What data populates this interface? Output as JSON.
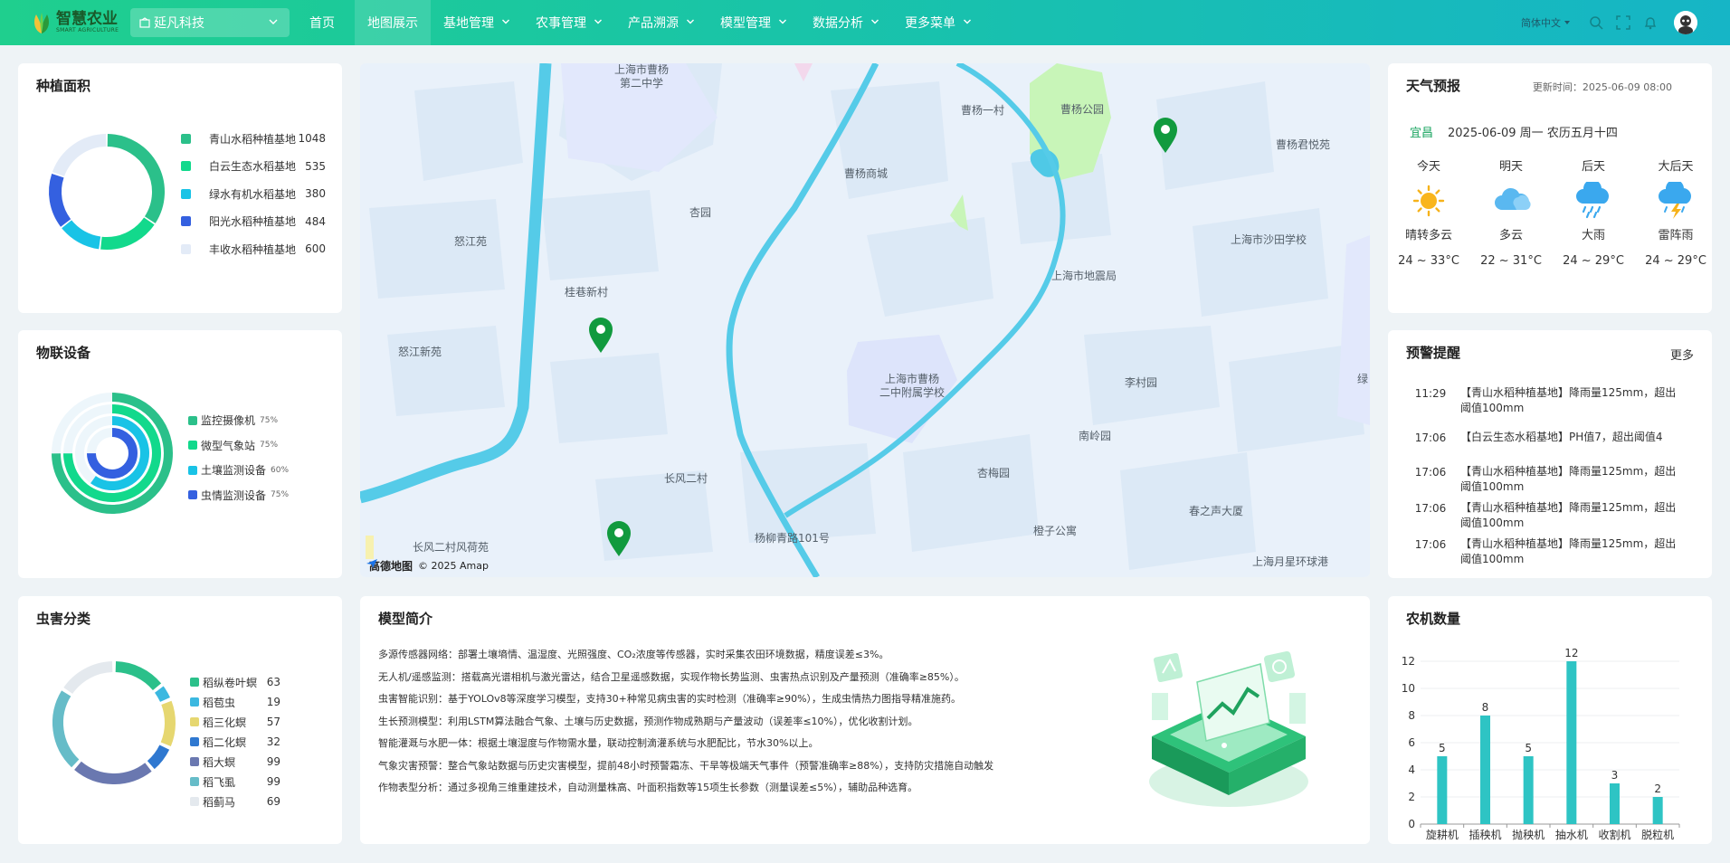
{
  "header": {
    "logo_title": "智慧农业",
    "logo_sub": "SMART AGRICULTURE",
    "company": "延凡科技",
    "nav": [
      {
        "label": "首页",
        "dropdown": false,
        "active": false
      },
      {
        "label": "地图展示",
        "dropdown": false,
        "active": true
      },
      {
        "label": "基地管理",
        "dropdown": true,
        "active": false
      },
      {
        "label": "农事管理",
        "dropdown": true,
        "active": false
      },
      {
        "label": "产品溯源",
        "dropdown": true,
        "active": false
      },
      {
        "label": "模型管理",
        "dropdown": true,
        "active": false
      },
      {
        "label": "数据分析",
        "dropdown": true,
        "active": false
      },
      {
        "label": "更多菜单",
        "dropdown": true,
        "active": false
      }
    ],
    "language": "简体中文"
  },
  "planting": {
    "title": "种植面积",
    "items": [
      {
        "name": "青山水稻种植基地",
        "value": 1048,
        "color": "#2bc08a"
      },
      {
        "name": "白云生态水稻基地",
        "value": 535,
        "color": "#12d98c"
      },
      {
        "name": "绿水有机水稻基地",
        "value": 380,
        "color": "#19c3e6"
      },
      {
        "name": "阳光水稻种植基地",
        "value": 484,
        "color": "#3460e0"
      },
      {
        "name": "丰收水稻种植基地",
        "value": 600,
        "color": "#e3ebf7"
      }
    ]
  },
  "iot": {
    "title": "物联设备",
    "items": [
      {
        "name": "监控摄像机",
        "percent": "75%",
        "fraction": 0.75,
        "color": "#2bc08a"
      },
      {
        "name": "微型气象站",
        "percent": "75%",
        "fraction": 0.75,
        "color": "#12d98c"
      },
      {
        "name": "土壤监测设备",
        "percent": "60%",
        "fraction": 0.6,
        "color": "#19c3e6"
      },
      {
        "name": "虫情监测设备",
        "percent": "75%",
        "fraction": 0.75,
        "color": "#3460e0"
      }
    ]
  },
  "pests": {
    "title": "虫害分类",
    "items": [
      {
        "name": "稻纵卷叶螟",
        "value": 63,
        "color": "#2bc08a"
      },
      {
        "name": "稻苞虫",
        "value": 19,
        "color": "#3bb8e0"
      },
      {
        "name": "稻三化螟",
        "value": 57,
        "color": "#e6d770"
      },
      {
        "name": "稻二化螟",
        "value": 32,
        "color": "#2f78d0"
      },
      {
        "name": "稻大螟",
        "value": 99,
        "color": "#6a78b0"
      },
      {
        "name": "稻飞虱",
        "value": 99,
        "color": "#66bcc8"
      },
      {
        "name": "稻蓟马",
        "value": 69,
        "color": "#e4e9ee"
      }
    ]
  },
  "map": {
    "labels": [
      {
        "id": "caoyang-2nd-school",
        "text": "上海市曹杨\n第二中学"
      },
      {
        "id": "caoyang-1village",
        "text": "曹杨一村"
      },
      {
        "id": "caoyang-park",
        "text": "曹杨公园"
      },
      {
        "id": "caoyang-mall",
        "text": "曹杨商城"
      },
      {
        "id": "caoyang-junyue",
        "text": "曹杨君悦苑"
      },
      {
        "id": "xingyuan",
        "text": "杏园"
      },
      {
        "id": "nujiang-yuan",
        "text": "怒江苑"
      },
      {
        "id": "shatian-school",
        "text": "上海市沙田学校"
      },
      {
        "id": "earthquake-bureau",
        "text": "上海市地震局"
      },
      {
        "id": "guixiang",
        "text": "桂巷新村"
      },
      {
        "id": "nujiang-new",
        "text": "怒江新苑"
      },
      {
        "id": "caoyang-2nd-affiliated",
        "text": "上海市曹杨\n二中附属学校"
      },
      {
        "id": "licunyuan",
        "text": "李村园"
      },
      {
        "id": "lu",
        "text": "绿"
      },
      {
        "id": "nanling",
        "text": "南岭园"
      },
      {
        "id": "changfeng2",
        "text": "长风二村"
      },
      {
        "id": "xingmei",
        "text": "杏梅园"
      },
      {
        "id": "chunzhisheng",
        "text": "春之声大厦"
      },
      {
        "id": "yangliuqing",
        "text": "杨柳青路101号"
      },
      {
        "id": "chengzi",
        "text": "橙子公寓"
      },
      {
        "id": "changfeng-lotus",
        "text": "长风二村风荷苑"
      },
      {
        "id": "yuexing",
        "text": "上海月星环球港"
      }
    ],
    "credit_logo": "高德地图",
    "credit": "© 2025 Amap"
  },
  "weather": {
    "title": "天气预报",
    "updated": "更新时间：2025-06-09 08:00",
    "city": "宜昌",
    "date": "2025-06-09 周一 农历五月十四",
    "days": [
      {
        "label": "今天",
        "icon": "sun-icon",
        "desc": "晴转多云",
        "temp": "24 ~ 33°C"
      },
      {
        "label": "明天",
        "icon": "cloud-icon",
        "desc": "多云",
        "temp": "22 ~ 31°C"
      },
      {
        "label": "后天",
        "icon": "rain-icon",
        "desc": "大雨",
        "temp": "24 ~ 29°C"
      },
      {
        "label": "大后天",
        "icon": "thunderstorm-icon",
        "desc": "雷阵雨",
        "temp": "24 ~ 29°C"
      }
    ]
  },
  "alerts": {
    "title": "预警提醒",
    "more": "更多",
    "items": [
      {
        "time": "11:29",
        "text": "【青山水稻种植基地】降雨量125mm，超出阈值100mm"
      },
      {
        "time": "17:06",
        "text": "【白云生态水稻基地】PH值7，超出阈值4"
      },
      {
        "time": "17:06",
        "text": "【青山水稻种植基地】降雨量125mm，超出阈值100mm"
      },
      {
        "time": "17:06",
        "text": "【青山水稻种植基地】降雨量125mm，超出阈值100mm"
      },
      {
        "time": "17:06",
        "text": "【青山水稻种植基地】降雨量125mm，超出阈值100mm"
      }
    ]
  },
  "intro": {
    "title": "模型简介",
    "lines": [
      "多源传感器网络：部署土壤墒情、温湿度、光照强度、CO₂浓度等传感器，实时采集农田环境数据，精度误差≤3%。",
      "无人机/遥感监测：搭载高光谱相机与激光雷达，结合卫星遥感数据，实现作物长势监测、虫害热点识别及产量预测（准确率≥85%）。",
      "虫害智能识别：基于YOLOv8等深度学习模型，支持30+种常见病虫害的实时检测（准确率≥90%），生成虫情热力图指导精准施药。",
      "生长预测模型：利用LSTM算法融合气象、土壤与历史数据，预测作物成熟期与产量波动（误差率≤10%），优化收割计划。",
      "智能灌溉与水肥一体：根据土壤湿度与作物需水量，联动控制滴灌系统与水肥配比，节水30%以上。",
      "气象灾害预警：整合气象站数据与历史灾害模型，提前48小时预警霜冻、干旱等极端天气事件（预警准确率≥88%），支持防灾措施自动触发",
      "作物表型分析：通过多视角三维重建技术，自动测量株高、叶面积指数等15项生长参数（测量误差≤5%），辅助品种选育。"
    ]
  },
  "machinery": {
    "title": "农机数量",
    "chart_data": {
      "type": "bar",
      "categories": [
        "旋耕机",
        "插秧机",
        "抛秧机",
        "抽水机",
        "收割机",
        "脱粒机"
      ],
      "values": [
        5,
        8,
        5,
        12,
        3,
        2
      ],
      "ylim": [
        0,
        12
      ],
      "yticks": [
        0,
        2,
        4,
        6,
        8,
        10,
        12
      ],
      "color": "#2ec4c4",
      "grid": true
    }
  }
}
